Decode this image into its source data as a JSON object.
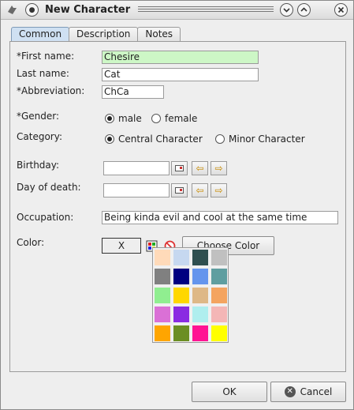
{
  "window": {
    "title": "New Character"
  },
  "tabs": [
    {
      "label": "Common",
      "active": true
    },
    {
      "label": "Description",
      "active": false
    },
    {
      "label": "Notes",
      "active": false
    }
  ],
  "form": {
    "first_name_label": "*First name:",
    "first_name_value": "Chesire",
    "last_name_label": "Last name:",
    "last_name_value": "Cat",
    "abbreviation_label": "*Abbreviation:",
    "abbreviation_value": "ChCa",
    "gender_label": "*Gender:",
    "gender_options": [
      {
        "label": "male",
        "selected": true
      },
      {
        "label": "female",
        "selected": false
      }
    ],
    "category_label": "Category:",
    "category_options": [
      {
        "label": "Central Character",
        "selected": true
      },
      {
        "label": "Minor Character",
        "selected": false
      }
    ],
    "birthday_label": "Birthday:",
    "birthday_value": "",
    "death_label": "Day of death:",
    "death_value": "",
    "occupation_label": "Occupation:",
    "occupation_value": "Being kinda evil and cool at the same time",
    "color_label": "Color:",
    "color_value": "X",
    "choose_color_label": "Choose Color"
  },
  "palette": {
    "colors": [
      "#ffdab9",
      "#c6d8f0",
      "#2f4f4f",
      "#c0c0c0",
      "#808080",
      "#000080",
      "#6495ed",
      "#5f9ea0",
      "#90ee90",
      "#ffd700",
      "#deb887",
      "#f4a460",
      "#da70d6",
      "#8a2be2",
      "#afeeee",
      "#f4b6b6",
      "#ffa500",
      "#6b8e23",
      "#ff1493",
      "#ffff00"
    ]
  },
  "buttons": {
    "ok_label": "OK",
    "cancel_label": "Cancel"
  },
  "icons": {
    "window_menu": "window-menu-icon",
    "pin": "pin-icon",
    "minimize": "chevron-down-icon",
    "maximize": "chevron-up-icon",
    "close": "close-icon"
  }
}
